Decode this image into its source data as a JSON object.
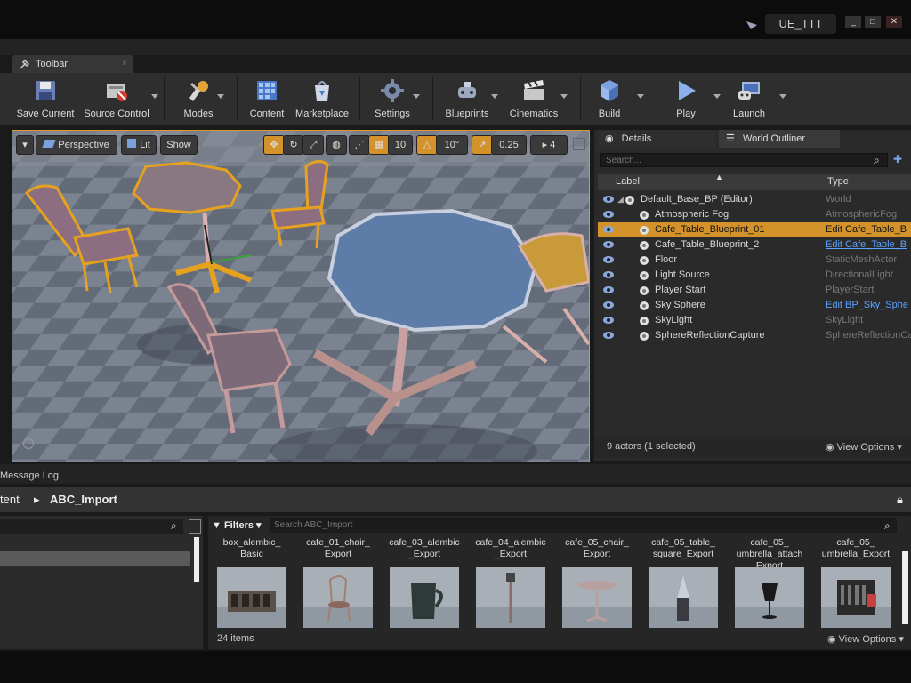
{
  "window": {
    "title": "UE_TTT",
    "controls": [
      "_",
      "□",
      "✕"
    ]
  },
  "toolbar_tab": "Toolbar",
  "toolbar": [
    {
      "label": "Save Current",
      "icon": "save-icon",
      "dropdown": false
    },
    {
      "label": "Source Control",
      "icon": "source-control-icon",
      "dropdown": true
    },
    {
      "label": "Modes",
      "icon": "modes-icon",
      "dropdown": true
    },
    {
      "label": "Content",
      "icon": "content-icon",
      "dropdown": false
    },
    {
      "label": "Marketplace",
      "icon": "marketplace-icon",
      "dropdown": false
    },
    {
      "label": "Settings",
      "icon": "settings-icon",
      "dropdown": true
    },
    {
      "label": "Blueprints",
      "icon": "blueprints-icon",
      "dropdown": true
    },
    {
      "label": "Cinematics",
      "icon": "cinematics-icon",
      "dropdown": true
    },
    {
      "label": "Build",
      "icon": "build-icon",
      "dropdown": true
    },
    {
      "label": "Play",
      "icon": "play-icon",
      "dropdown": true
    },
    {
      "label": "Launch",
      "icon": "launch-icon",
      "dropdown": true
    }
  ],
  "viewport": {
    "perspective": "Perspective",
    "lit": "Lit",
    "show": "Show",
    "grid_snap": "10",
    "rotation_snap": "10°",
    "scale_snap": "0.25",
    "camera_speed": "4"
  },
  "right_panel": {
    "tabs": [
      "Details",
      "World Outliner"
    ],
    "search_placeholder": "Search...",
    "columns": {
      "label": "Label",
      "type": "Type"
    },
    "rows": [
      {
        "name": "Default_Base_BP (Editor)",
        "type": "World",
        "link": false,
        "selected": false,
        "icon": "world-icon"
      },
      {
        "name": "Atmospheric Fog",
        "type": "AtmosphericFog",
        "link": false,
        "selected": false,
        "icon": "fog-icon"
      },
      {
        "name": "Cafe_Table_Blueprint_01",
        "type": "Edit Cafe_Table_B",
        "link": true,
        "selected": true,
        "icon": "blueprint-actor-icon"
      },
      {
        "name": "Cafe_Table_Blueprint_2",
        "type": "Edit Cafe_Table_B",
        "link": true,
        "selected": false,
        "icon": "blueprint-actor-icon"
      },
      {
        "name": "Floor",
        "type": "StaticMeshActor",
        "link": false,
        "selected": false,
        "icon": "static-mesh-icon"
      },
      {
        "name": "Light Source",
        "type": "DirectionalLight",
        "link": false,
        "selected": false,
        "icon": "directional-light-icon"
      },
      {
        "name": "Player Start",
        "type": "PlayerStart",
        "link": false,
        "selected": false,
        "icon": "player-start-icon"
      },
      {
        "name": "Sky Sphere",
        "type": "Edit BP_Sky_Sphe",
        "link": true,
        "selected": false,
        "icon": "sky-sphere-icon"
      },
      {
        "name": "SkyLight",
        "type": "SkyLight",
        "link": false,
        "selected": false,
        "icon": "skylight-icon"
      },
      {
        "name": "SphereReflectionCapture",
        "type": "SphereReflectionCa",
        "link": false,
        "selected": false,
        "icon": "reflection-capture-icon"
      }
    ],
    "actor_count": "9 actors (1 selected)",
    "view_options": "View Options"
  },
  "message_log_tab": "Message Log",
  "content_browser": {
    "breadcrumb_root": "tent",
    "breadcrumb_folder": "ABC_Import",
    "filters": "Filters",
    "search_placeholder": "Search ABC_Import",
    "assets": [
      {
        "label": "box_alembic_\nBasic",
        "thumb": "box"
      },
      {
        "label": "cafe_01_chair_\nExport",
        "thumb": "chair"
      },
      {
        "label": "cafe_03_alembic\n_Export",
        "thumb": "cup"
      },
      {
        "label": "cafe_04_alembic\n_Export",
        "thumb": "lamp"
      },
      {
        "label": "cafe_05_chair_\nExport",
        "thumb": "table"
      },
      {
        "label": "cafe_05_table_\nsquare_Export",
        "thumb": "vase"
      },
      {
        "label": "cafe_05_\numbrella_attach\nExport",
        "thumb": "glass"
      },
      {
        "label": "cafe_05_\numbrella_Export",
        "thumb": "machine"
      }
    ],
    "item_count": "24 items",
    "view_options": "View Options"
  },
  "colors": {
    "accent": "#d4922b",
    "link": "#5aa3ff",
    "panel": "#2a2a2a"
  }
}
